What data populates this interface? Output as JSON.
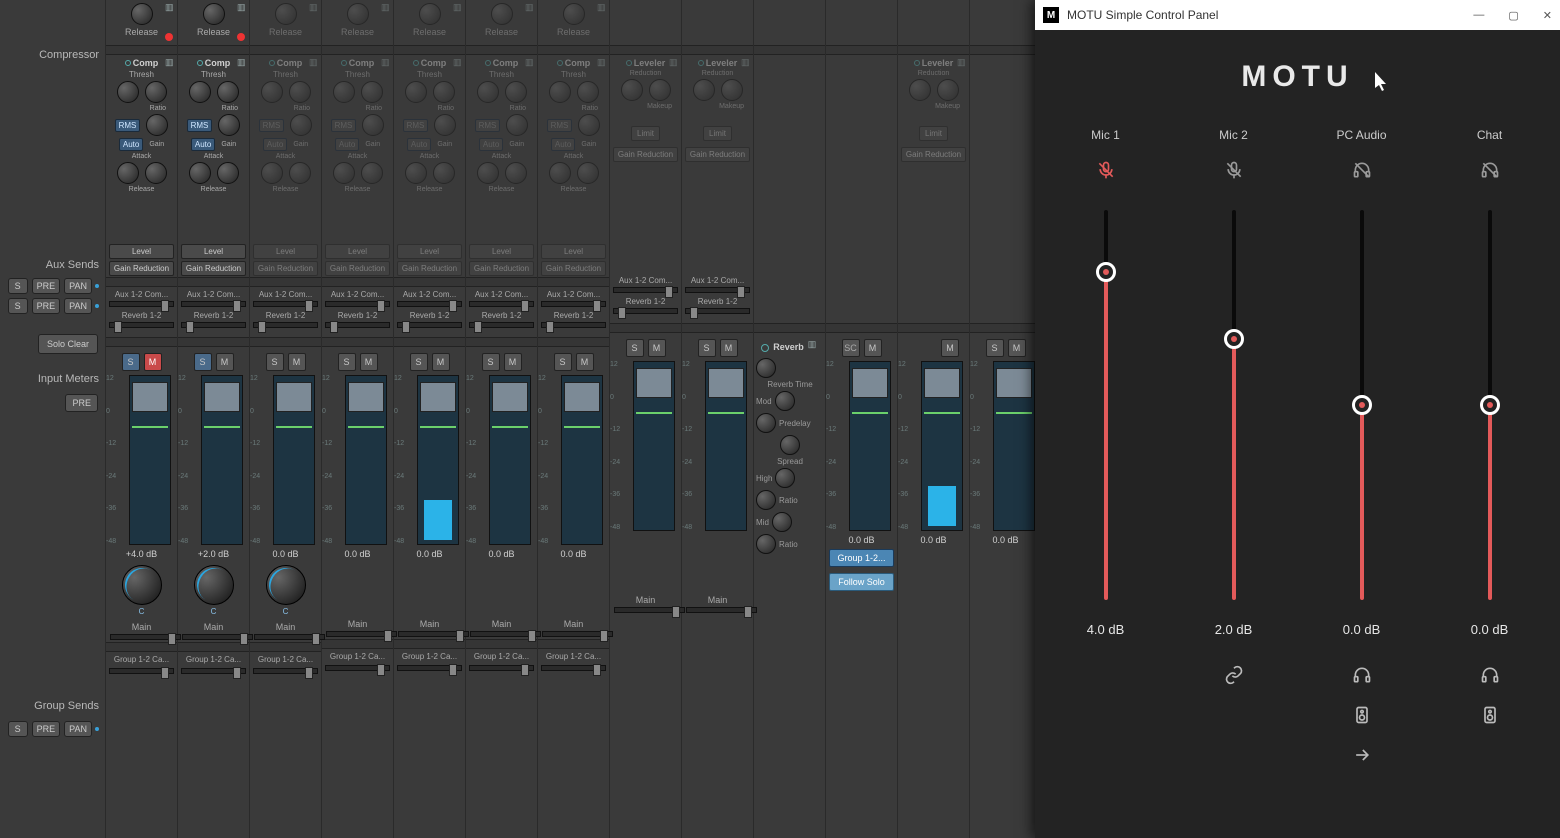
{
  "labels": {
    "compressor": "Compressor",
    "aux_sends": "Aux Sends",
    "solo_clear": "Solo Clear",
    "input_meters": "Input Meters",
    "pre": "PRE",
    "group_sends": "Group Sends",
    "s": "S",
    "pan": "PAN",
    "prebtn": "PRE"
  },
  "top_release": "Release",
  "comp": {
    "title": "Comp",
    "thresh": "Thresh",
    "ratio": "Ratio",
    "rms": "RMS",
    "auto": "Auto",
    "gain": "Gain",
    "attack": "Attack",
    "release": "Release",
    "level": "Level",
    "gain_reduction": "Gain Reduction"
  },
  "leveler": {
    "title": "Leveler",
    "reduction": "Reduction",
    "makeup": "Makeup",
    "limit": "Limit",
    "gain_reduction": "Gain Reduction"
  },
  "aux": {
    "label1": "Aux 1-2 Com...",
    "label2": "Reverb 1-2"
  },
  "sm": {
    "s": "S",
    "m": "M",
    "sc": "SC"
  },
  "marks": [
    "12",
    "0",
    "-12",
    "-24",
    "-36",
    "-48"
  ],
  "channels": [
    {
      "db": "+4.0 dB",
      "active": true,
      "mute": true,
      "pan": "C",
      "main": "Main",
      "aux": true,
      "group": true,
      "dim": false,
      "led": "red",
      "sig": 0
    },
    {
      "db": "+2.0 dB",
      "active": true,
      "mute": false,
      "pan": "C",
      "main": "Main",
      "aux": true,
      "group": true,
      "dim": false,
      "led": "red",
      "sig": 0
    },
    {
      "db": "0.0 dB",
      "active": false,
      "mute": false,
      "pan": "C",
      "main": "Main",
      "aux": true,
      "group": true,
      "dim": true,
      "led": "",
      "sig": 0
    },
    {
      "db": "0.0 dB",
      "active": false,
      "mute": false,
      "pan": "",
      "main": "Main",
      "aux": true,
      "group": true,
      "dim": true,
      "led": "",
      "sig": 0
    },
    {
      "db": "0.0 dB",
      "active": false,
      "mute": false,
      "pan": "",
      "main": "Main",
      "aux": true,
      "group": true,
      "dim": true,
      "led": "",
      "sig": 40
    },
    {
      "db": "0.0 dB",
      "active": false,
      "mute": false,
      "pan": "",
      "main": "Main",
      "aux": true,
      "group": true,
      "dim": true,
      "led": "",
      "sig": 0
    },
    {
      "db": "0.0 dB",
      "active": false,
      "mute": false,
      "pan": "",
      "main": "Main",
      "aux": true,
      "group": true,
      "dim": true,
      "led": "",
      "sig": 0
    },
    {
      "db": "",
      "active": false,
      "mute": false,
      "pan": "",
      "main": "Main",
      "aux": true,
      "group": false,
      "leveler": true,
      "dim": true,
      "led": "",
      "sig": 0
    },
    {
      "db": "",
      "active": false,
      "mute": false,
      "pan": "",
      "main": "Main",
      "aux": true,
      "group": false,
      "leveler": true,
      "dim": true,
      "led": "",
      "sig": 0
    }
  ],
  "reverb": {
    "title": "Reverb",
    "time": "Reverb Time",
    "mod": "Mod",
    "predelay": "Predelay",
    "spread": "Spread",
    "high": "High",
    "mid": "Mid",
    "ratio": "Ratio",
    "group": "Group 1-2...",
    "follow": "Follow Solo"
  },
  "group_item": "Group 1-2 Ca...",
  "out_channels": [
    {
      "db": "0.0 dB",
      "sc": true,
      "sig": 0
    },
    {
      "db": "0.0 dB",
      "sc": false,
      "sig": 40,
      "leveler": true
    },
    {
      "db": "0.0 dB",
      "sc": false,
      "sig": 0
    }
  ],
  "window": {
    "title": "MOTU Simple Control Panel",
    "logo": "MOTU",
    "lanes": [
      {
        "name": "Mic 1",
        "icon": "mic-off-red",
        "db": "4.0 dB",
        "fill": 84
      },
      {
        "name": "Mic 2",
        "icon": "mic-off",
        "db": "2.0 dB",
        "fill": 67
      },
      {
        "name": "PC Audio",
        "icon": "headset-off",
        "db": "0.0 dB",
        "fill": 50
      },
      {
        "name": "Chat",
        "icon": "headset-off",
        "db": "0.0 dB",
        "fill": 50
      }
    ]
  }
}
